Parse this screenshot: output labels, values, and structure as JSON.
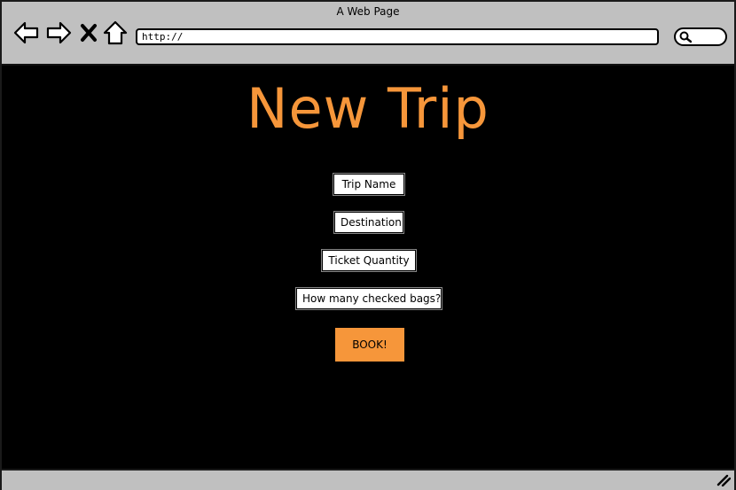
{
  "window": {
    "title": "A Web Page"
  },
  "toolbar": {
    "back_icon": "back-arrow-icon",
    "forward_icon": "forward-arrow-icon",
    "stop_icon": "close-icon",
    "home_icon": "home-icon",
    "url": "http://",
    "search_icon": "search-icon"
  },
  "page": {
    "title": "New Trip",
    "fields": [
      {
        "label": "Trip Name"
      },
      {
        "label": "Destination"
      },
      {
        "label": "Ticket Quantity"
      },
      {
        "label": "How many checked bags?"
      }
    ],
    "submit_label": "BOOK!"
  },
  "colors": {
    "accent": "#f6963a",
    "background": "#000000",
    "chrome": "#c0c0c0"
  }
}
